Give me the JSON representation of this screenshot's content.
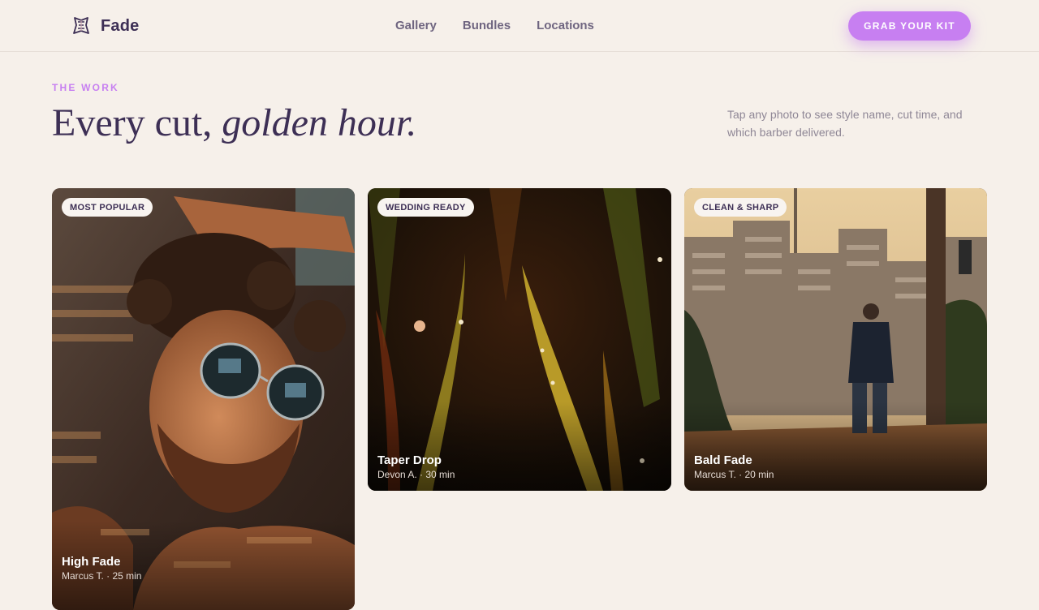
{
  "brand": {
    "name": "Fade",
    "logo_icon": "ornate-crest-icon"
  },
  "nav": {
    "items": [
      {
        "label": "Gallery"
      },
      {
        "label": "Bundles"
      },
      {
        "label": "Locations"
      }
    ]
  },
  "cta": {
    "label": "GRAB YOUR KIT",
    "color": "#c77ff1"
  },
  "hero": {
    "eyebrow": "THE WORK",
    "headline_plain": "Every cut, ",
    "headline_italic": "golden hour.",
    "hint": "Tap any photo to see style name, cut time, and which barber delivered."
  },
  "colors": {
    "background": "#f6f0ea",
    "ink": "#3d2f55",
    "accent": "#c77ff1",
    "muted": "#8f8796"
  },
  "gallery": {
    "cards": [
      {
        "badge": "MOST POPULAR",
        "title": "High Fade",
        "meta": "Marcus T. · 25 min"
      },
      {
        "badge": "WEDDING READY",
        "title": "Taper Drop",
        "meta": "Devon A. · 30 min"
      },
      {
        "badge": "CLEAN & SHARP",
        "title": "Bald Fade",
        "meta": "Marcus T. · 20 min"
      }
    ]
  }
}
